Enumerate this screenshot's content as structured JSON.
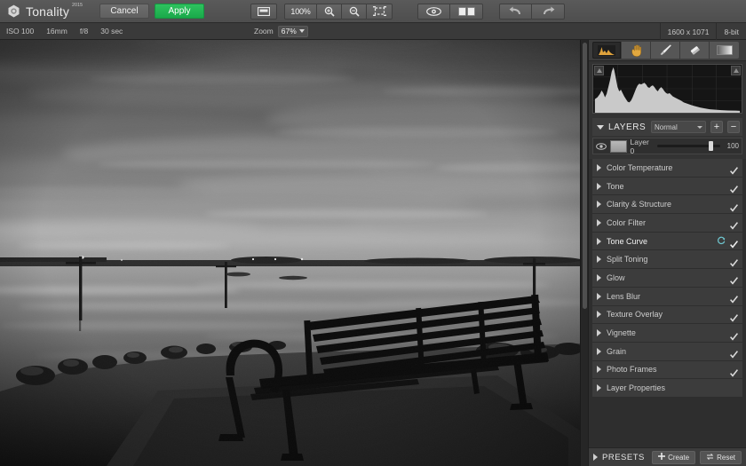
{
  "app": {
    "name": "Tonality",
    "name_superscript": "2015",
    "logo_icon": "hexagon-logo-icon"
  },
  "topbar": {
    "cancel_label": "Cancel",
    "apply_label": "Apply",
    "fit_icon": "fit-to-screen-icon",
    "zoom_100_label": "100%",
    "zoom_in_icon": "zoom-in-icon",
    "zoom_out_icon": "zoom-out-icon",
    "crop_icon": "crop-icon",
    "preview_icon": "eye-preview-icon",
    "compare_icon": "split-compare-icon",
    "undo_icon": "undo-arrow-icon",
    "redo_icon": "redo-arrow-icon"
  },
  "infobar": {
    "iso": "ISO 100",
    "focal": "16mm",
    "aperture": "f/8",
    "shutter": "30 sec",
    "zoom_label": "Zoom",
    "zoom_value": "67%",
    "dimensions": "1600 x 1071",
    "bit_depth": "8-bit"
  },
  "right_toolbar": {
    "tools": [
      {
        "name": "histogram-tool",
        "icon": "histogram-icon",
        "selected": true
      },
      {
        "name": "hand-tool",
        "icon": "hand-icon",
        "selected": false
      },
      {
        "name": "brush-tool",
        "icon": "brush-icon",
        "selected": false
      },
      {
        "name": "eraser-tool",
        "icon": "eraser-icon",
        "selected": false
      },
      {
        "name": "gradient-tool",
        "icon": "gradient-icon",
        "selected": false
      }
    ]
  },
  "histogram": {
    "clip_left_icon": "shadow-clipping-icon",
    "clip_right_icon": "highlight-clipping-icon"
  },
  "layers": {
    "title": "LAYERS",
    "blend_mode": "Normal",
    "add_label": "+",
    "remove_label": "−",
    "items": [
      {
        "name": "Layer 0",
        "opacity": "100",
        "visible": true
      }
    ]
  },
  "adjustments": [
    {
      "label": "Color Temperature",
      "enabled": true,
      "reset": false,
      "active": false
    },
    {
      "label": "Tone",
      "enabled": true,
      "reset": false,
      "active": false
    },
    {
      "label": "Clarity & Structure",
      "enabled": true,
      "reset": false,
      "active": false
    },
    {
      "label": "Color Filter",
      "enabled": true,
      "reset": false,
      "active": false
    },
    {
      "label": "Tone Curve",
      "enabled": true,
      "reset": true,
      "active": true
    },
    {
      "label": "Split Toning",
      "enabled": true,
      "reset": false,
      "active": false
    },
    {
      "label": "Glow",
      "enabled": true,
      "reset": false,
      "active": false
    },
    {
      "label": "Lens Blur",
      "enabled": true,
      "reset": false,
      "active": false
    },
    {
      "label": "Texture Overlay",
      "enabled": true,
      "reset": false,
      "active": false
    },
    {
      "label": "Vignette",
      "enabled": true,
      "reset": false,
      "active": false
    },
    {
      "label": "Grain",
      "enabled": true,
      "reset": false,
      "active": false
    },
    {
      "label": "Photo Frames",
      "enabled": true,
      "reset": false,
      "active": false
    },
    {
      "label": "Layer Properties",
      "enabled": false,
      "reset": false,
      "active": false
    }
  ],
  "presets": {
    "title": "PRESETS",
    "create_label": "Create",
    "reset_label": "Reset",
    "create_icon": "plus-icon",
    "reset_icon": "reset-arrows-icon"
  },
  "canvas": {
    "image_description": "Black and white photo of a park bench silhouetted against a cloudy sunset over a calm lake"
  },
  "colors": {
    "accent_green": "#1fae50",
    "panel_bg": "#333333",
    "toolbar_bg": "#565656",
    "row_bg": "#3c3c3c",
    "text": "#cdcdcd"
  }
}
